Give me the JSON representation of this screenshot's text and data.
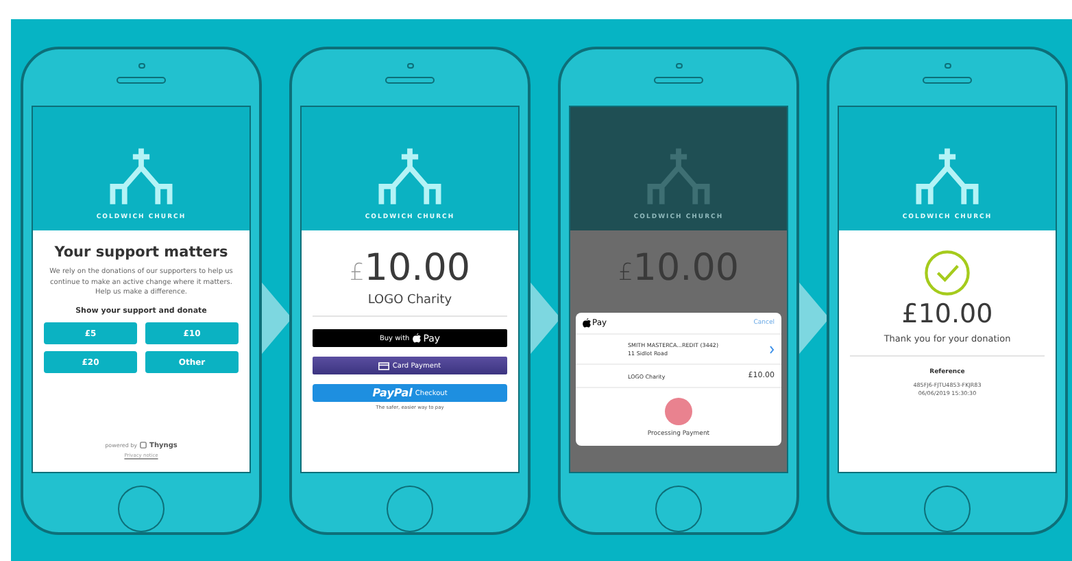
{
  "screens": [
    {
      "kind": "appeal",
      "dimmed": false,
      "brand": "COLDWICH CHURCH",
      "heading": "Your support matters",
      "body": "We rely on the donations of our supporters to help us continue to make an active change where it matters. Help us make a difference.",
      "prompt": "Show your support and donate",
      "amounts": [
        "£5",
        "£10",
        "£20",
        "Other"
      ],
      "powered_by": "powered by",
      "provider": "Thyngs",
      "privacy": "Privacy notice"
    },
    {
      "kind": "checkout",
      "dimmed": false,
      "brand": "COLDWICH CHURCH",
      "currency": "£",
      "amount": "10.00",
      "charity": "LOGO Charity",
      "apple_pay": {
        "prefix": "Buy with",
        "label": "Pay"
      },
      "card_button": "Card Payment",
      "paypal": {
        "label": "PayPal",
        "suffix": "Checkout"
      },
      "paypal_caption": "The safer, easier way to pay"
    },
    {
      "kind": "apple_pay",
      "dimmed": true,
      "brand": "COLDWICH CHURCH",
      "currency": "£",
      "amount": "10.00",
      "sheet": {
        "title": "Pay",
        "cancel": "Cancel",
        "card": "SMITH MASTERCA...REDIT (3442)",
        "address": "11 Sidlot Road",
        "payee": "LOGO Charity",
        "total": "£10.00",
        "status": "Processing Payment"
      }
    },
    {
      "kind": "receipt",
      "dimmed": false,
      "brand": "COLDWICH CHURCH",
      "amount": "£10.00",
      "thanks": "Thank you for your donation",
      "reference_label": "Reference",
      "reference": "485FJ6-FJTU4853-FKJR83",
      "timestamp": "06/06/2019 15:30:30"
    }
  ]
}
